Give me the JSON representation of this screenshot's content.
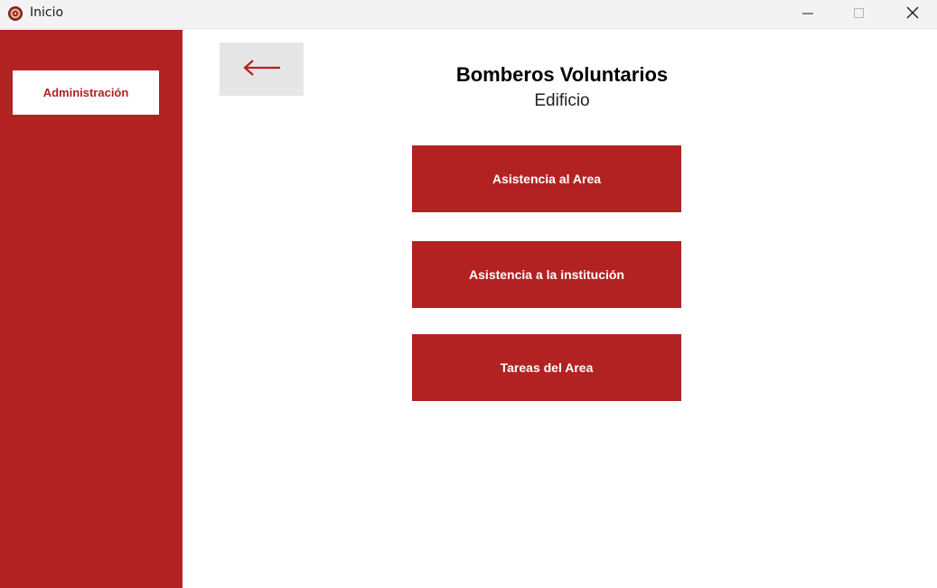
{
  "window": {
    "title": "Inicio",
    "app_icon": "firefighter-badge-icon",
    "controls": [
      "minimize-icon",
      "maximize-icon",
      "close-icon"
    ]
  },
  "sidebar": {
    "items": [
      {
        "label": "Administración"
      }
    ]
  },
  "header": {
    "back_icon": "left-arrow-icon",
    "title": "Bomberos Voluntarios",
    "subtitle": "Edificio"
  },
  "main": {
    "buttons": [
      {
        "label": "Asistencia al Area"
      },
      {
        "label": "Asistencia a la institución"
      },
      {
        "label": "Tareas del Area"
      }
    ]
  },
  "colors": {
    "primary_red": "#b22222",
    "back_button_bg": "#e6e6e6",
    "titlebar_bg": "#f3f3f3"
  }
}
